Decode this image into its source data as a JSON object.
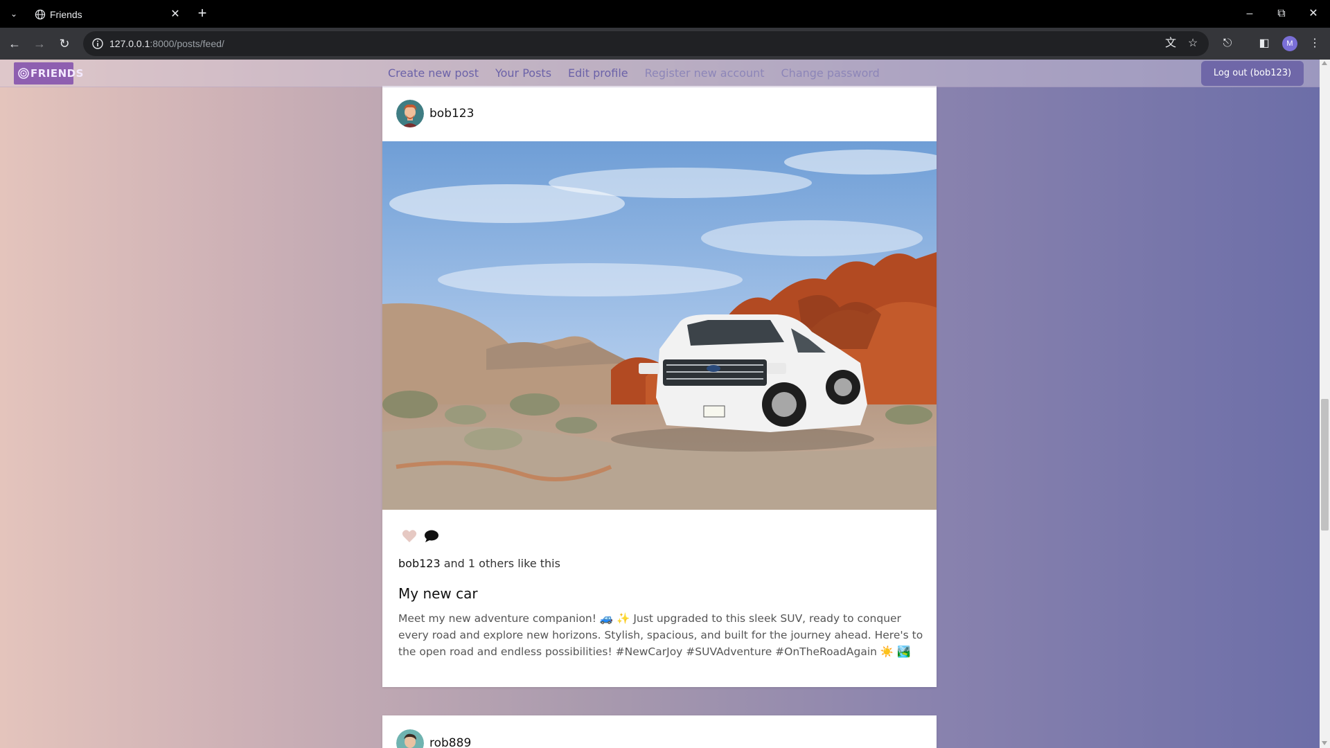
{
  "browser": {
    "tab_title": "Friends",
    "url_host": "127.0.0.1",
    "url_rest": ":8000/posts/feed/",
    "profile_initial": "M"
  },
  "site": {
    "logo_text": "FRIENDS",
    "nav": [
      "Create new post",
      "Your Posts",
      "Edit profile",
      "Register new account",
      "Change password"
    ],
    "logout_label": "Log out (bob123)"
  },
  "posts": [
    {
      "username": "bob123",
      "like_user": "bob123",
      "like_rest": " and 1 others like this",
      "title": "My new car",
      "body": "Meet my new adventure companion! 🚙 ✨ Just upgraded to this sleek SUV, ready to conquer every road and explore new horizons. Stylish, spacious, and built for the journey ahead. Here's to the open road and endless possibilities! #NewCarJoy #SUVAdventure #OnTheRoadAgain ☀️ 🏞️"
    },
    {
      "username": "rob889"
    }
  ],
  "colors": {
    "accent": "#6f67a8",
    "logo_bg": "#8e5fb0",
    "nav_link": "#6b62a8"
  }
}
